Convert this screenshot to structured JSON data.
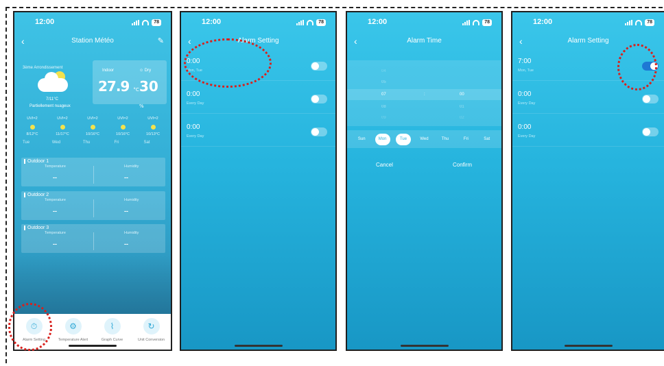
{
  "status_bar": {
    "time": "12:00",
    "battery": "78"
  },
  "screen1": {
    "title": "Station Météo",
    "weather": {
      "area": "3ème Arrondissement",
      "temp_range": "7/11°C",
      "condition": "Partiellement nuageux"
    },
    "indoor": {
      "label": "Indoor",
      "dry_label": "Dry",
      "temp": "27.9",
      "temp_unit": "°C",
      "humidity": "30",
      "humidity_unit": "%"
    },
    "forecast": [
      {
        "uv": "UVI=2",
        "range": "8/12°C",
        "day": "Tue"
      },
      {
        "uv": "UVI=2",
        "range": "11/17°C",
        "day": "Wed"
      },
      {
        "uv": "UVI=2",
        "range": "10/16°C",
        "day": "Thu"
      },
      {
        "uv": "UVI=2",
        "range": "10/16°C",
        "day": "Fri"
      },
      {
        "uv": "UVI=2",
        "range": "10/13°C",
        "day": "Sat"
      }
    ],
    "outdoor": [
      {
        "title": "Outdoor 1",
        "temp_label": "Temperature",
        "hum_label": "Humidity",
        "temp": "--",
        "hum": "--"
      },
      {
        "title": "Outdoor 2",
        "temp_label": "Temperature",
        "hum_label": "Humidity",
        "temp": "--",
        "hum": "--"
      },
      {
        "title": "Outdoor 3",
        "temp_label": "Temperature",
        "hum_label": "Humidity",
        "temp": "--",
        "hum": "--"
      }
    ],
    "tabs": [
      {
        "label": "Alarm Setting",
        "icon": "stopwatch-icon"
      },
      {
        "label": "Temperature Alert",
        "icon": "gear-icon"
      },
      {
        "label": "Graph Curve",
        "icon": "graph-icon"
      },
      {
        "label": "Unit Conversion",
        "icon": "refresh-icon"
      }
    ]
  },
  "screen2": {
    "title": "Alarm Setting",
    "alarms": [
      {
        "time": "0:00",
        "repeat": "Mon, Tue",
        "on": false
      },
      {
        "time": "0:00",
        "repeat": "Every Day",
        "on": false
      },
      {
        "time": "0:00",
        "repeat": "Every Day",
        "on": false
      }
    ]
  },
  "screen3": {
    "title": "Alarm Time",
    "hours": [
      "04",
      "05",
      "07",
      "08",
      "09"
    ],
    "minutes": [
      "",
      "",
      "00",
      "01",
      "02"
    ],
    "separator": ":",
    "days": [
      "Sun",
      "Mon",
      "Tue",
      "Wed",
      "Thu",
      "Fri",
      "Sat"
    ],
    "selected_days": [
      "Mon",
      "Tue"
    ],
    "cancel": "Cancel",
    "confirm": "Confirm"
  },
  "screen4": {
    "title": "Alarm Setting",
    "alarms": [
      {
        "time": "7:00",
        "repeat": "Mon, Tue",
        "on": true
      },
      {
        "time": "0:00",
        "repeat": "Every Day",
        "on": false
      },
      {
        "time": "0:00",
        "repeat": "Every Day",
        "on": false
      }
    ]
  },
  "colors": {
    "annotation": "#d8201c",
    "accent": "#1e78d4",
    "sky": "#3ec3e6"
  }
}
